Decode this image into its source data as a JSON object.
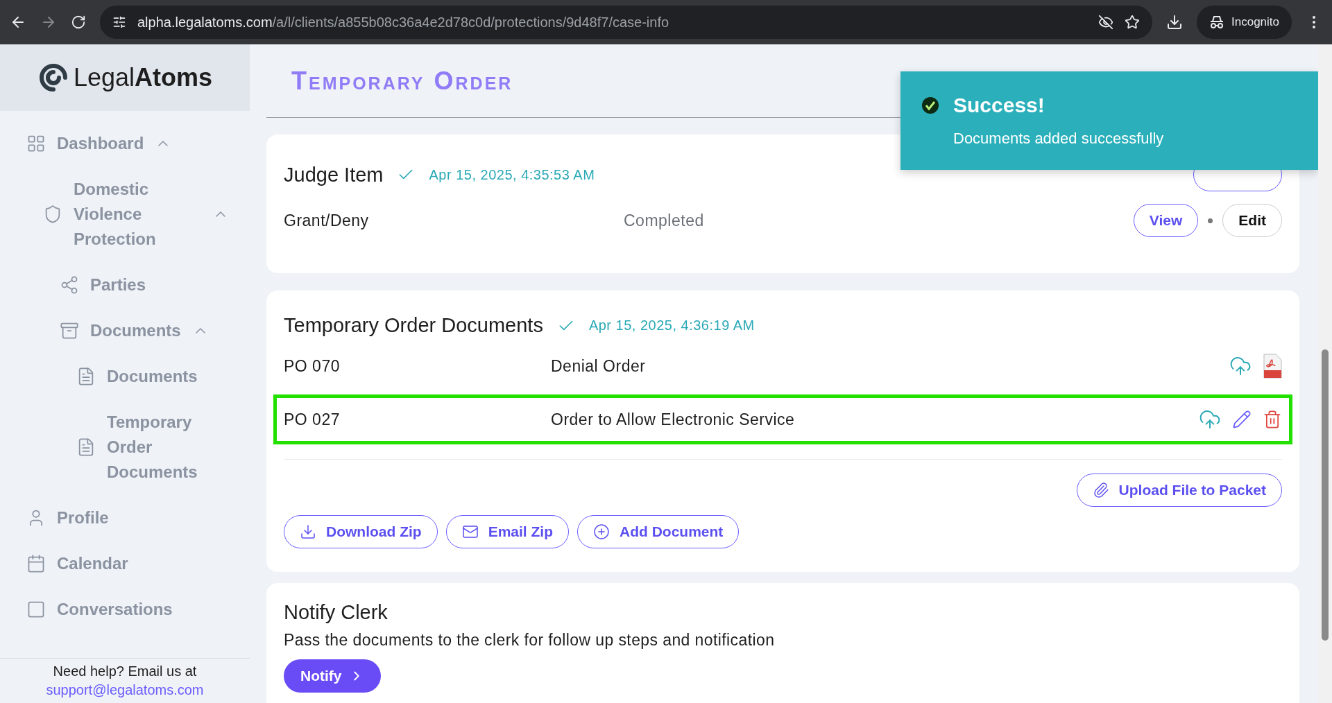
{
  "browser": {
    "url_host": "alpha.legalatoms.com",
    "url_path": "/a/l/clients/a855b08c36a4e2d78c0d/protections/9d48f7/case-info",
    "profile": "Incognito"
  },
  "sidebar": {
    "logo_light": "Legal",
    "logo_bold": "Atoms",
    "items": [
      {
        "label": "Dashboard",
        "expanded": true,
        "children": [
          {
            "label": "Domestic Violence Protection",
            "expanded": true,
            "children": [
              {
                "label": "Parties"
              },
              {
                "label": "Documents",
                "expanded": true,
                "children": [
                  {
                    "label": "Documents"
                  },
                  {
                    "label": "Temporary Order Documents"
                  }
                ]
              }
            ]
          }
        ]
      },
      {
        "label": "Profile"
      },
      {
        "label": "Calendar"
      },
      {
        "label": "Conversations"
      }
    ],
    "help_text": "Need help? Email us at",
    "help_email": "support@legalatoms.com"
  },
  "page_title": "Temporary Order",
  "judge_card": {
    "title": "Judge Item",
    "timestamp": "Apr 15, 2025, 4:35:53 AM",
    "row": {
      "name": "Grant/Deny",
      "status": "Completed",
      "view": "View",
      "edit": "Edit"
    }
  },
  "documents_card": {
    "title": "Temporary Order Documents",
    "timestamp": "Apr 15, 2025, 4:36:19 AM",
    "rows": [
      {
        "code": "PO 070",
        "title": "Denial Order",
        "kind": "file",
        "selected": false
      },
      {
        "code": "PO 027",
        "title": "Order to Allow Electronic Service",
        "kind": "draft",
        "selected": true
      }
    ],
    "upload": "Upload File to Packet",
    "buttons": [
      {
        "label": "Download Zip",
        "kind": "download"
      },
      {
        "label": "Email Zip",
        "kind": "email"
      },
      {
        "label": "Add Document",
        "kind": "add"
      }
    ]
  },
  "notify_card": {
    "title": "Notify Clerk",
    "text": "Pass the documents to the clerk for follow up steps and notification",
    "button": "Notify"
  },
  "toast": {
    "title": "Success!",
    "message": "Documents added successfully"
  }
}
